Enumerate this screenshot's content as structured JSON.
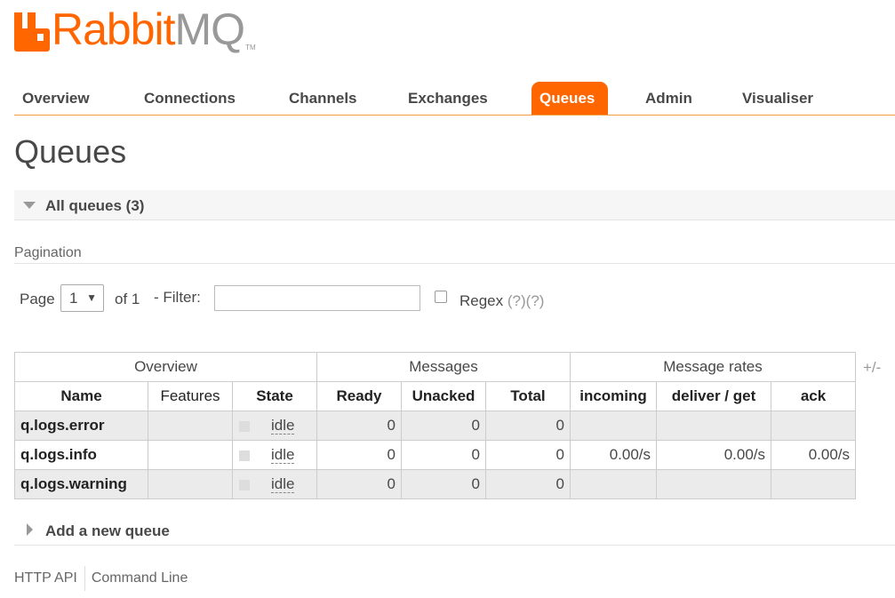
{
  "logo": {
    "part1": "Rabbit",
    "part2": "MQ",
    "tm": "TM",
    "icon": "rabbitmq-logo-icon"
  },
  "nav": [
    {
      "label": "Overview",
      "active": false
    },
    {
      "label": "Connections",
      "active": false
    },
    {
      "label": "Channels",
      "active": false
    },
    {
      "label": "Exchanges",
      "active": false
    },
    {
      "label": "Queues",
      "active": true
    },
    {
      "label": "Admin",
      "active": false
    },
    {
      "label": "Visualiser",
      "active": false
    }
  ],
  "page_title": "Queues",
  "all_queues": {
    "label": "All queues (3)",
    "icon": "triangle-down-icon"
  },
  "pagination": {
    "title": "Pagination",
    "page_label": "Page",
    "page_value": "1",
    "of_label": "of 1",
    "filter_label": "- Filter:",
    "filter_value": "",
    "regex_label": "Regex",
    "help1": "(?)",
    "help2": "(?)"
  },
  "table": {
    "groups": [
      "Overview",
      "Messages",
      "Message rates"
    ],
    "columns": [
      "Name",
      "Features",
      "State",
      "Ready",
      "Unacked",
      "Total",
      "incoming",
      "deliver / get",
      "ack"
    ],
    "toggle": "+/-",
    "rows": [
      {
        "name": "q.logs.error",
        "features": "",
        "state": "idle",
        "ready": "0",
        "unacked": "0",
        "total": "0",
        "incoming": "",
        "deliver": "",
        "ack": ""
      },
      {
        "name": "q.logs.info",
        "features": "",
        "state": "idle",
        "ready": "0",
        "unacked": "0",
        "total": "0",
        "incoming": "0.00/s",
        "deliver": "0.00/s",
        "ack": "0.00/s"
      },
      {
        "name": "q.logs.warning",
        "features": "",
        "state": "idle",
        "ready": "0",
        "unacked": "0",
        "total": "0",
        "incoming": "",
        "deliver": "",
        "ack": ""
      }
    ]
  },
  "add_queue": {
    "label": "Add a new queue",
    "icon": "triangle-right-icon"
  },
  "footer": {
    "links": [
      "HTTP API",
      "Command Line"
    ]
  },
  "colors": {
    "accent": "#ff6600",
    "text": "#484848",
    "muted": "#999999",
    "row_alt": "#ebebeb"
  }
}
